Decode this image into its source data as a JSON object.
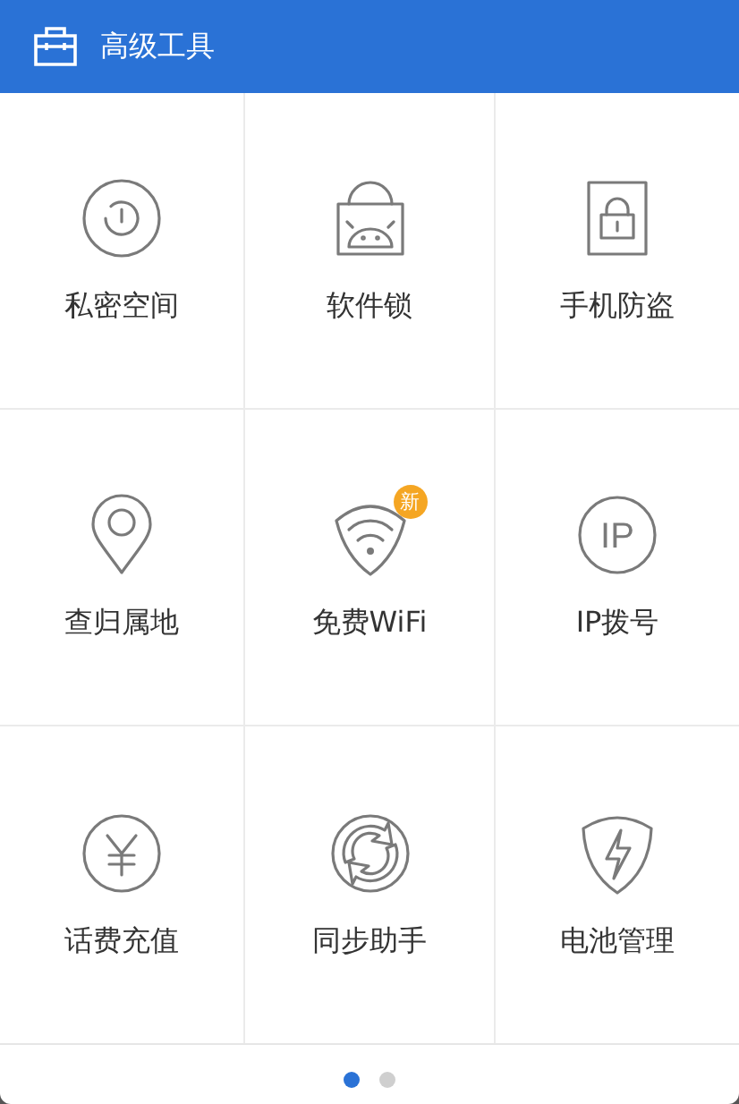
{
  "header": {
    "title": "高级工具"
  },
  "tools": [
    {
      "label": "私密空间"
    },
    {
      "label": "软件锁"
    },
    {
      "label": "手机防盗"
    },
    {
      "label": "查归属地"
    },
    {
      "label": "免费WiFi",
      "badge": "新"
    },
    {
      "label": "IP拨号",
      "icon_text": "IP"
    },
    {
      "label": "话费充值"
    },
    {
      "label": "同步助手"
    },
    {
      "label": "电池管理"
    }
  ],
  "pages": [
    {
      "selected": true
    },
    {
      "selected": false
    }
  ]
}
